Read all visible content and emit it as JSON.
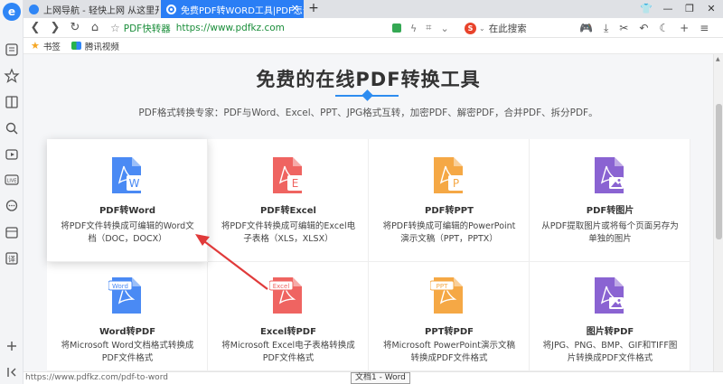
{
  "tabs": [
    {
      "label": "上网导航 - 轻快上网 从这里开始"
    },
    {
      "label": "免费PDF转WORD工具|PDF怎么转换"
    }
  ],
  "address": {
    "site_name": "PDF快转器",
    "url": "https://www.pdfkz.com"
  },
  "search": {
    "placeholder": "在此搜索"
  },
  "bookmarks": [
    {
      "label": "书签"
    },
    {
      "label": "腾讯视频"
    }
  ],
  "page": {
    "title": "免费的在线PDF转换工具",
    "subtitle": "PDF格式转换专家：PDF与Word、Excel、PPT、JPG格式互转，加密PDF、解密PDF，合并PDF、拆分PDF。"
  },
  "tools": [
    {
      "name": "PDF转Word",
      "desc": "将PDF文件转换成可编辑的Word文档（DOC，DOCX）",
      "color": "#4a8af4",
      "badge": "W",
      "badge_label": ""
    },
    {
      "name": "PDF转Excel",
      "desc": "将PDF文件转换成可编辑的Excel电子表格（XLS，XLSX）",
      "color": "#ef6461",
      "badge": "E",
      "badge_label": ""
    },
    {
      "name": "PDF转PPT",
      "desc": "将PDF转换成可编辑的PowerPoint演示文稿（PPT，PPTX）",
      "color": "#f5a845",
      "badge": "P",
      "badge_label": ""
    },
    {
      "name": "PDF转图片",
      "desc": "从PDF提取图片或将每个页面另存为单独的图片",
      "color": "#8a63d2",
      "badge": "",
      "badge_label": ""
    },
    {
      "name": "Word转PDF",
      "desc": "将Microsoft Word文档格式转换成PDF文件格式",
      "color": "#4a8af4",
      "badge": "",
      "badge_label": "Word"
    },
    {
      "name": "Excel转PDF",
      "desc": "将Microsoft Excel电子表格转换成PDF文件格式",
      "color": "#ef6461",
      "badge": "",
      "badge_label": "Excel"
    },
    {
      "name": "PPT转PDF",
      "desc": "将Microsoft PowerPoint演示文稿转换成PDF文件格式",
      "color": "#f5a845",
      "badge": "",
      "badge_label": "PPT"
    },
    {
      "name": "图片转PDF",
      "desc": "将JPG、PNG、BMP、GIF和TIFF图片转换成PDF文件格式",
      "color": "#8a63d2",
      "badge": "",
      "badge_label": ""
    }
  ],
  "status": {
    "url": "https://www.pdfkz.com/pdf-to-word",
    "tooltip": "文档1 - Word"
  }
}
